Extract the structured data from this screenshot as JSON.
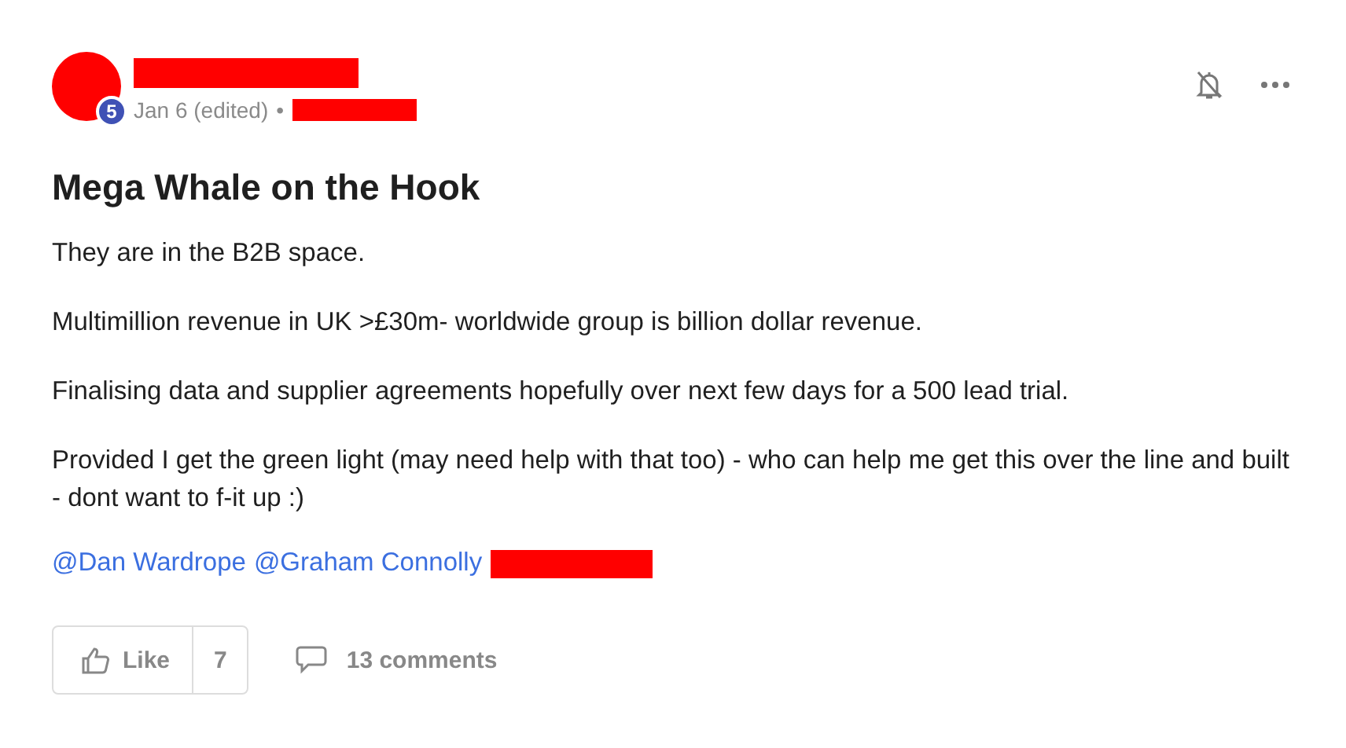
{
  "post": {
    "author_badge": "5",
    "date": "Jan 6 (edited)",
    "separator": "•",
    "title": "Mega Whale on the Hook",
    "paragraphs": [
      "They are in the B2B space.",
      "Multimillion revenue in UK >£30m- worldwide group is billion dollar revenue.",
      "Finalising data and supplier agreements hopefully over next few days for a 500 lead trial.",
      "Provided I get the green light (may need help with that too) - who can help me get this over the line and built - dont want to f-it up :)"
    ],
    "mentions": [
      "@Dan Wardrope",
      "@Graham Connolly"
    ],
    "like": {
      "label": "Like",
      "count": "7"
    },
    "comments": "13 comments"
  }
}
